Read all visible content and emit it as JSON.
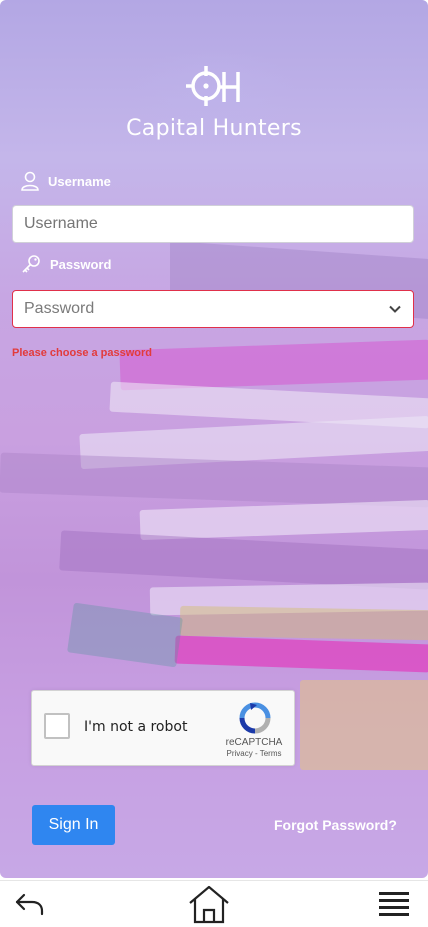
{
  "brand": {
    "name": "Capital Hunters",
    "logo_icon": "crosshair-ch-logo"
  },
  "form": {
    "username_label": "Username",
    "username_placeholder": "Username",
    "username_value": "",
    "password_label": "Password",
    "password_placeholder": "Password",
    "password_value": "",
    "password_error": "Please choose a password"
  },
  "captcha": {
    "label": "I'm not a robot",
    "brand": "reCAPTCHA",
    "links": "Privacy - Terms",
    "checked": false
  },
  "actions": {
    "sign_in": "Sign In",
    "forgot_password": "Forgot Password?"
  },
  "bottom_nav": {
    "icons": [
      "back-arrow-icon",
      "home-icon",
      "menu-icon"
    ]
  },
  "colors": {
    "accent": "#2f86f0",
    "error": "#e23b3b",
    "background": "#c4a9e6"
  }
}
